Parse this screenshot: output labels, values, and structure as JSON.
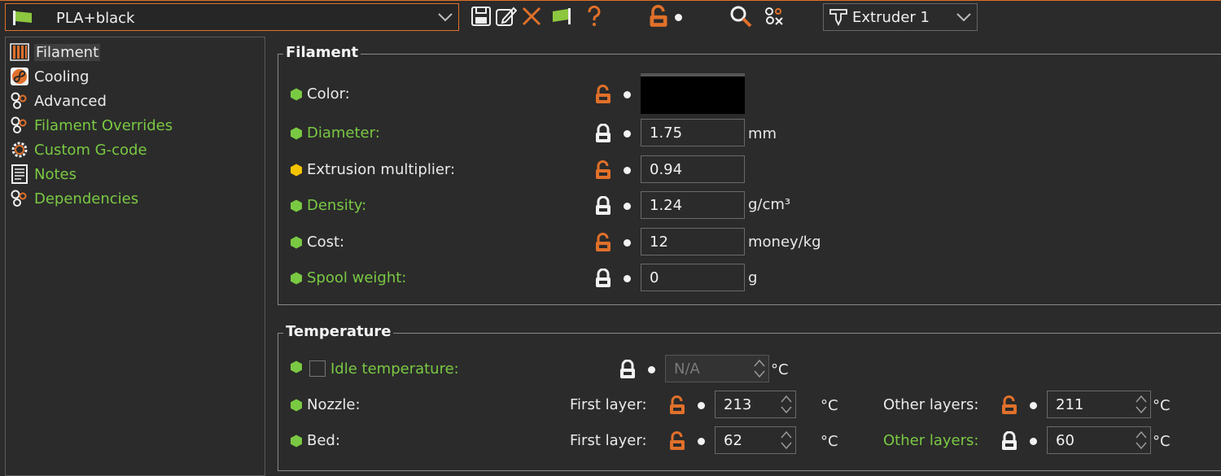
{
  "toolbar": {
    "preset_name": "PLA+black",
    "extruder": "Extruder 1",
    "icons": [
      "save-icon",
      "rename-icon",
      "delete-icon",
      "compare-icon",
      "help-icon",
      "lock-open-icon",
      "search-icon",
      "settings-icon"
    ]
  },
  "sidebar": {
    "items": [
      {
        "label": "Filament",
        "icon": "filament-icon",
        "state": "selected"
      },
      {
        "label": "Cooling",
        "icon": "cooling-fan-icon",
        "state": "normal"
      },
      {
        "label": "Advanced",
        "icon": "advanced-gears-icon",
        "state": "normal"
      },
      {
        "label": "Filament Overrides",
        "icon": "overrides-gears-icon",
        "state": "modified"
      },
      {
        "label": "Custom G-code",
        "icon": "gcode-gear-icon",
        "state": "modified"
      },
      {
        "label": "Notes",
        "icon": "notes-icon",
        "state": "modified"
      },
      {
        "label": "Dependencies",
        "icon": "dependencies-gears-icon",
        "state": "modified"
      }
    ]
  },
  "filament_group": {
    "title": "Filament",
    "color": {
      "label": "Color:",
      "value": "#000000"
    },
    "diameter": {
      "label": "Diameter:",
      "value": "1.75",
      "unit": "mm"
    },
    "extrusion_multiplier": {
      "label": "Extrusion multiplier:",
      "value": "0.94"
    },
    "density": {
      "label": "Density:",
      "value": "1.24",
      "unit": "g/cm³"
    },
    "cost": {
      "label": "Cost:",
      "value": "12",
      "unit": "money/kg"
    },
    "spool_weight": {
      "label": "Spool weight:",
      "value": "0",
      "unit": "g"
    }
  },
  "temperature_group": {
    "title": "Temperature",
    "idle": {
      "label": "Idle temperature:",
      "value": "N/A",
      "unit": "°C"
    },
    "nozzle": {
      "label": "Nozzle:",
      "first_label": "First layer:",
      "first_value": "213",
      "other_label": "Other layers:",
      "other_value": "211",
      "unit": "°C"
    },
    "bed": {
      "label": "Bed:",
      "first_label": "First layer:",
      "first_value": "62",
      "other_label": "Other layers:",
      "other_value": "60",
      "unit": "°C"
    }
  },
  "colors": {
    "accent_orange": "#e0702a",
    "modified_green": "#7ac943",
    "system_yellow": "#f5c400",
    "background": "#2b2b2b"
  }
}
